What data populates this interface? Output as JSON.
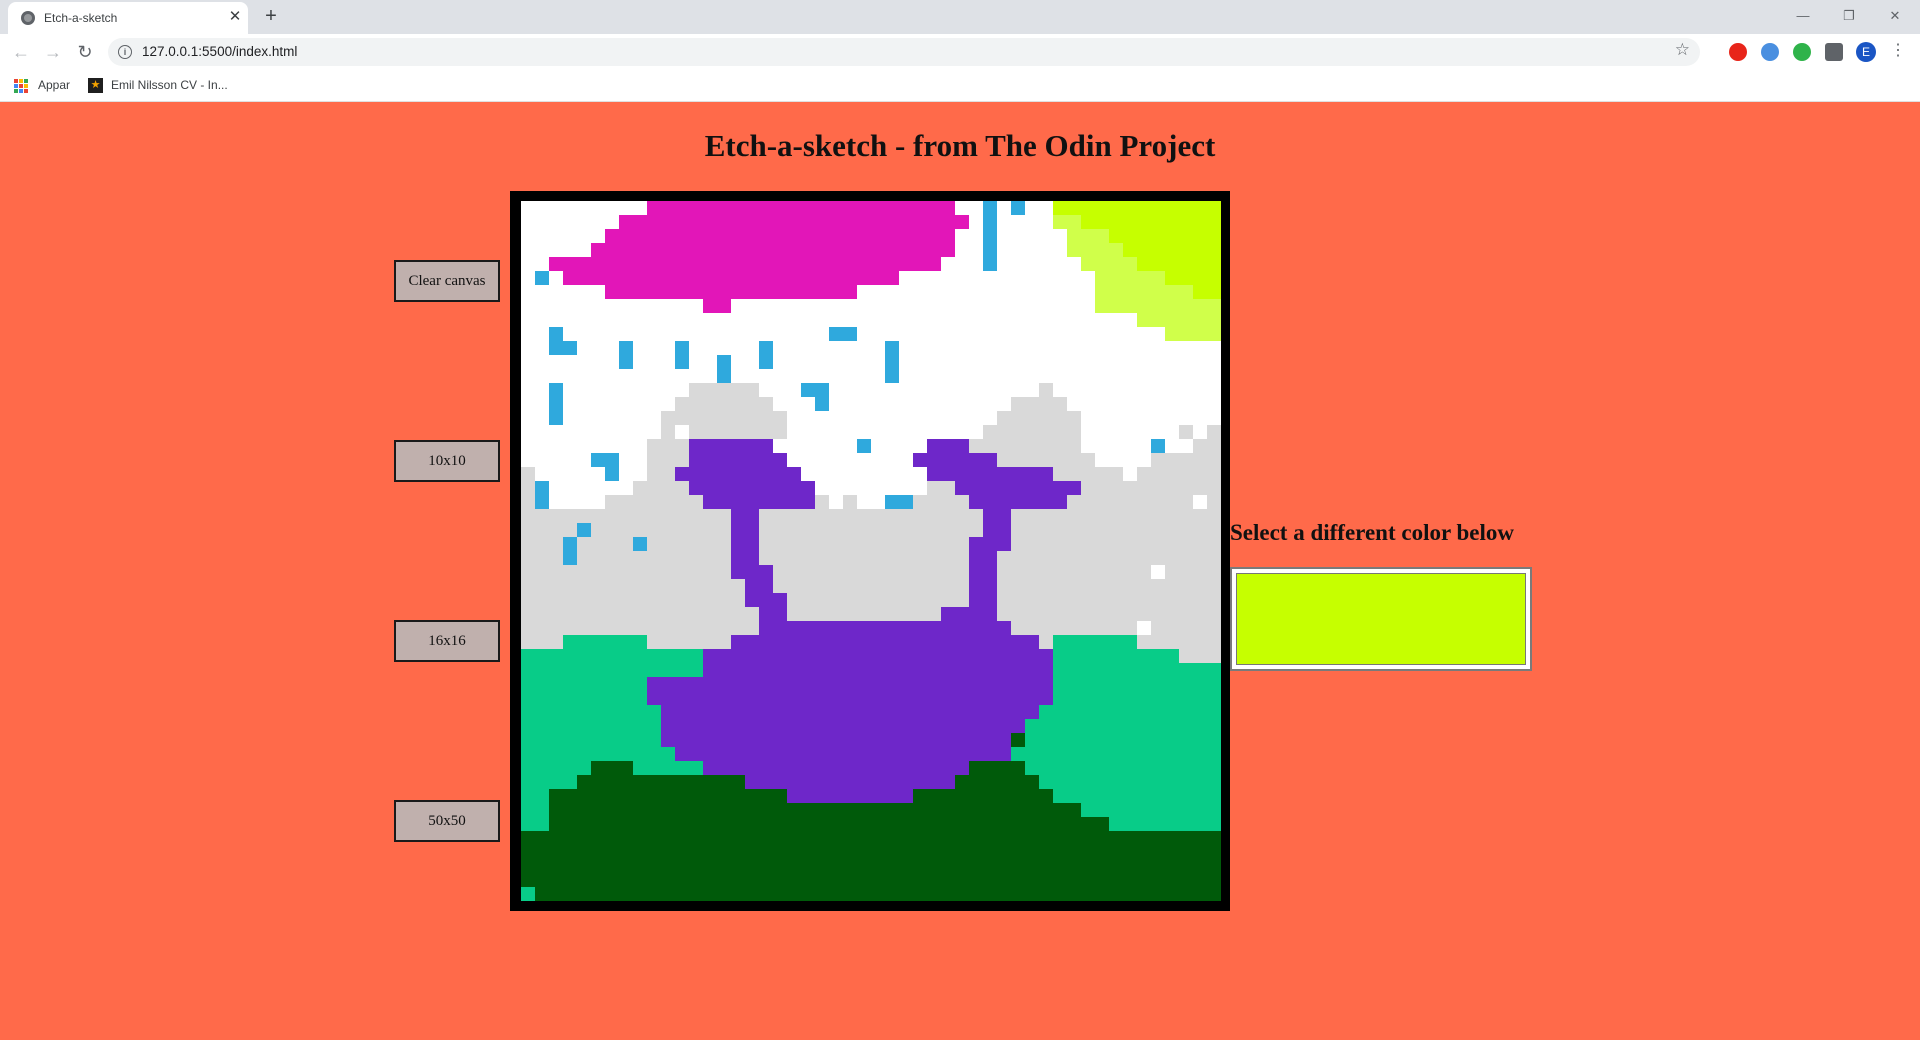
{
  "browser": {
    "tab_title": "Etch-a-sketch",
    "tab_close": "✕",
    "new_tab": "+",
    "url": "127.0.0.1:5500/index.html",
    "profile_initial": "E",
    "bookmarks": [
      {
        "label": "Appar",
        "icon": "apps-grid-icon"
      },
      {
        "label": "Emil Nilsson CV - In...",
        "icon": "star-favicon"
      }
    ]
  },
  "page": {
    "title": "Etch-a-sketch - from The Odin Project",
    "buttons": {
      "clear": "Clear canvas",
      "size_10": "10x10",
      "size_16": "16x16",
      "size_50": "50x50"
    },
    "color_label": "Select a different color below",
    "selected_color": "#c6ff00"
  },
  "canvas": {
    "grid_size": 50,
    "palette": {
      "W": "#ffffff",
      "M": "#e216b8",
      "B": "#2fa9dd",
      "Y": "#c6ff00",
      "L": "#d0ff4a",
      "G": "#d9d9d9",
      "P": "#6e27c9",
      "T": "#08cc88",
      "D": "#005a0a"
    },
    "rows": [
      "WWWWWWWWWMMMMMMMMMMMMMMMMMMMMMMWWBWBWWYYYYYYYYYYYY",
      "WWWWWWWMMMMMMMMMMMMMMMMMMMMMMMMMWBWWWWLLYYYYYYYYYY",
      "WWWWWWMMMMMMMMMMMMMMMMMMMMMMMMMWWBWWWWWLLLYYYYYYYY",
      "WWWWWMMMMMMMMMMMMMMMMMMMMMMMMMMWWBWWWWWLLLLYYYYYYY",
      "WWMMMMMMMMMMMMMMMMMMMMMMMMMMMMWWWBWWWWWWLLLLYYYYYY",
      "WBWMMMMMMMMMMMMMMMMMMMMMMMMWWWWWWWWWWWWWWLLLLLYYYY",
      "WWWWWWMMMMMMMMMMMMMMMMMMWWWWWWWWWWWWWWWWWLLLLLLLYY",
      "WWWWWWWWWWWWWMMWWWWWWWWWWWWWWWWWWWWWWWWWWLLLLLLLLL",
      "WWWWWWWWWWWWWWWWWWWWWWWWWWWWWWWWWWWWWWWWWWWWLLLLLL",
      "WWBWWWWWWWWWWWWWWWWWWWBBWWWWWWWWWWWWWWWWWWWWWWLLLL",
      "WWBBWWWBWWWBWWWWWBWWWWWWWWBWWWWWWWWWWWWWWWWWWWWWWW",
      "WWWWWWWBWWWBWWBWWBWWWWWWWWBWWWWWWWWWWWWWWWWWWWWWWW",
      "WWWWWWWWWWWWWWBWWWWWWWWWWWBWWWWWWWWWWWWWWWWWWWWWWW",
      "WWBWWWWWWWWWGGGGGWWWBBWWWWWWWWWWWWWWWGWWWWWWWWWWWW",
      "WWBWWWWWWWWGGGGGGGWWWBWWWWWWWWWWWWWGGGGWWWWWWWWWWW",
      "WWBWWWWWWWGGGGGGGGGWWWWWWWWWWWWWWWGGGGGGWWWWWWWWWW",
      "WWWWWWWWWWGWGGGGGGGWWWWWWWWWWWWWWGGGGGGGWWWWWWWGWG",
      "WWWWWWWWWGGGPPPPPPWWWWWWBWWWWPPPGGGGGGGGWWWWWBWWGG",
      "WWWWWBBWWGGGPPPPPPPWWWWWWWWWPPPPPPGGGGGGGWWWWGGGGG",
      "GWWWWWBWWGGPPPPPPPPPWWWWWWWWWPPPPPPPPPGGGGGWGGGGGG",
      "GBWWWWWWGGGGPPPPPPPPPWWWWWWWWGGPPPPPPPPPGGGGGGGGGG",
      "GBWWWWGGGGGGGPPPPPPPPGWGWWBBGGGGPPPPPPPGGGGGGGGGWG",
      "GGGGGGGGGGGGGGGPPGGGGGGGGGGGGGGGGPPGGGGGGGGGGGGGGG",
      "GGGGBGGGGGGGGGGPPGGGGGGGGGGGGGGGGPPGGGGGGGGGGGGGGG",
      "GGGBGGGGBGGGGGGPPGGGGGGGGGGGGGGGPPPGGGGGGGGGGGGGGG",
      "GGGBGGGGGGGGGGGPPGGGGGGGGGGGGGGGPPGGGGGGGGGGGGGGGG",
      "GGGGGGGGGGGGGGGPPPGGGGGGGGGGGGGGPPGGGGGGGGGGGWGGGG",
      "GGGGGGGGGGGGGGGGPPGGGGGGGGGGGGGGPPGGGGGGGGGGGGGGGG",
      "GGGGGGGGGGGGGGGGPPPGGGGGGGGGGGGGPPGGGGGGGGGGGGGGGG",
      "GGGGGGGGGGGGGGGGGPPGGGGGGGGGGGPPPPGGGGGGGGGGGGGGGG",
      "GGGGGGGGGGGGGGGGGPPPPPPPPPPPPPPPPPPGGGGGGGGGWGGGGG",
      "GGGTTTTTTGGGGGGPPPPPPPPPPPPPPPPPPPPPPGTTTTTTGGGGGG",
      "TTTTTTTTTTTTTPPPPPPPPPPPPPPPPPPPPPPPPPTTTTTTTTTGGG",
      "TTTTTTTTTTTTTPPPPPPPPPPPPPPPPPPPPPPPPPTTTTTTTTTTTT",
      "TTTTTTTTTPPPPPPPPPPPPPPPPPPPPPPPPPPPPPTTTTTTTTTTTT",
      "TTTTTTTTTPPPPPPPPPPPPPPPPPPPPPPPPPPPPPTTTTTTTTTTTT",
      "TTTTTTTTTTPPPPPPPPPPPPPPPPPPPPPPPPPPPTTTTTTTTTTTTT",
      "TTTTTTTTTTPPPPPPPPPPPPPPPPPPPPPPPPPPTTTTTTTTTTTTTT",
      "TTTTTTTTTTPPPPPPPPPPPPPPPPPPPPPPPPPDTTTTTTTTTTTTTT",
      "TTTTTTTTTTTPPPPPPPPPPPPPPPPPPPPPPPPTTTTTTTTTTTTTTT",
      "TTTTTDDDTTTTTPPPPPPPPPPPPPPPPPPPDDDDTTTTTTTTTTTTTT",
      "TTTTDDDDDDDDDDDDPPPPPPPPPPPPPPPDDDDDDTTTTTTTTTTTTT",
      "TTDDDDDDDDDDDDDDDDDPPPPPPPPPDDDDDDDDDDTTTTTTTTTTTT",
      "TTDDDDDDDDDDDDDDDDDDDDDDDDDDDDDDDDDDDDDDTTTTTTTTTT",
      "TTDDDDDDDDDDDDDDDDDDDDDDDDDDDDDDDDDDDDDDDDTTTTTTTT",
      "DDDDDDDDDDDDDDDDDDDDDDDDDDDDDDDDDDDDDDDDDDDDDDDDDD",
      "DDDDDDDDDDDDDDDDDDDDDDDDDDDDDDDDDDDDDDDDDDDDDDDDDD",
      "DDDDDDDDDDDDDDDDDDDDDDDDDDDDDDDDDDDDDDDDDDDDDDDDDD",
      "DDDDDDDDDDDDDDDDDDDDDDDDDDDDDDDDDDDDDDDDDDDDDDDDDD",
      "TDDDDDDDDDDDDDDDDDDDDDDDDDDDDDDDDDDDDDDDDDDDDDDDDD"
    ]
  }
}
